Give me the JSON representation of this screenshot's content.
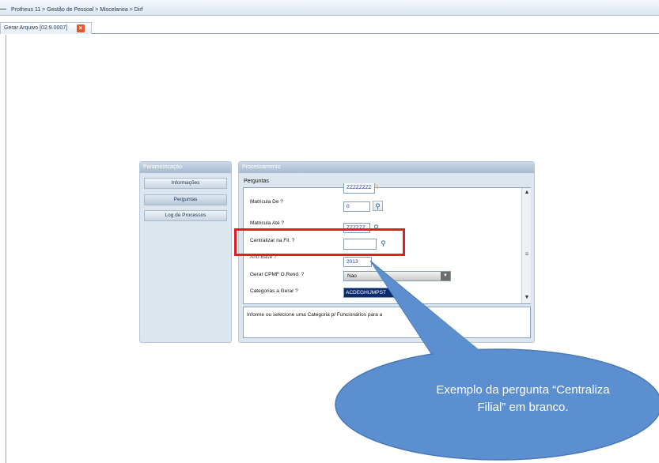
{
  "breadcrumb": "Protheus 11 > Gestão de Pessoal > Miscelanea > Dirf",
  "tab": {
    "label": "Gerar Arquivo [02.9.0007]",
    "close_icon": "close-icon"
  },
  "parametrizacao": {
    "title": "Parametrização",
    "buttons": [
      "Informações",
      "Perguntas",
      "Log de Processos"
    ]
  },
  "processamento": {
    "title": "Processamento",
    "section_label": "Perguntas",
    "partial_top_value": "ZZZZZZZZ",
    "questions": {
      "matricula_de": {
        "label": "Matricula De ?",
        "value": "0"
      },
      "matricula_ate": {
        "label": "Matricula Até ?",
        "value": "ZZZZZZ"
      },
      "centralizar": {
        "label": "Centralizar na Fil. ?",
        "value": ""
      },
      "ano_base": {
        "label": "Ano Base ?",
        "value": "2013"
      },
      "gerar_cpmf": {
        "label": "Gerar CPMF O.Rend. ?",
        "value": "Nao"
      },
      "categorias": {
        "label": "Categorias a Gerar ?",
        "value": "ACDEGHIJMPST"
      }
    },
    "help_text": "Informe ou selecione uma Categoria p/ Funcionários para a"
  },
  "callout": {
    "line1": "Exemplo da pergunta “Centraliza",
    "line2": "Filial” em branco.",
    "color": "#5b8fd0"
  },
  "highlight_color": "#e02020"
}
